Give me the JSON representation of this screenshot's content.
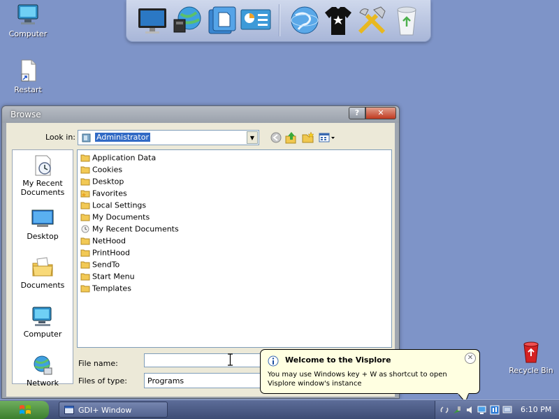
{
  "desktop": {
    "icons": [
      {
        "label": "Computer"
      },
      {
        "label": "Restart"
      },
      {
        "label": "Recycle Bin"
      }
    ]
  },
  "dock": {
    "items": [
      "monitor-icon",
      "network-globe-icon",
      "document-icon",
      "control-panel-icon",
      "globe-icon",
      "tshirt-icon",
      "tools-icon",
      "recycle-bin-icon"
    ]
  },
  "dialog": {
    "title": "Browse",
    "help_label": "?",
    "close_label": "✕",
    "look_in_label": "Look in:",
    "look_in_value": "Administrator",
    "places": [
      {
        "label": "My Recent Documents"
      },
      {
        "label": "Desktop"
      },
      {
        "label": "Documents"
      },
      {
        "label": "Computer"
      },
      {
        "label": "Network"
      }
    ],
    "files": [
      {
        "name": "Application Data",
        "icon": "folder-icon"
      },
      {
        "name": "Cookies",
        "icon": "folder-icon"
      },
      {
        "name": "Desktop",
        "icon": "folder-icon"
      },
      {
        "name": "Favorites",
        "icon": "favorites-folder-icon"
      },
      {
        "name": "Local Settings",
        "icon": "folder-icon"
      },
      {
        "name": "My Documents",
        "icon": "folder-icon"
      },
      {
        "name": "My Recent Documents",
        "icon": "recent-folder-icon"
      },
      {
        "name": "NetHood",
        "icon": "folder-icon"
      },
      {
        "name": "PrintHood",
        "icon": "folder-icon"
      },
      {
        "name": "SendTo",
        "icon": "folder-icon"
      },
      {
        "name": "Start Menu",
        "icon": "folder-icon"
      },
      {
        "name": "Templates",
        "icon": "folder-icon"
      }
    ],
    "file_name_label": "File name:",
    "file_name_value": "",
    "files_of_type_label": "Files of type:",
    "files_of_type_value": "Programs"
  },
  "balloon": {
    "title": "Welcome to the Visplore",
    "text": "You may use Windows key + W as shortcut to open Visplore window's instance",
    "close_label": "✕"
  },
  "taskbar": {
    "task_label": "GDI+ Window",
    "clock": "6:10 PM"
  },
  "colors": {
    "desktop": "#7e94c8",
    "selection": "#316ac5",
    "balloon": "#ffffe1",
    "close_button": "#c0391f"
  }
}
